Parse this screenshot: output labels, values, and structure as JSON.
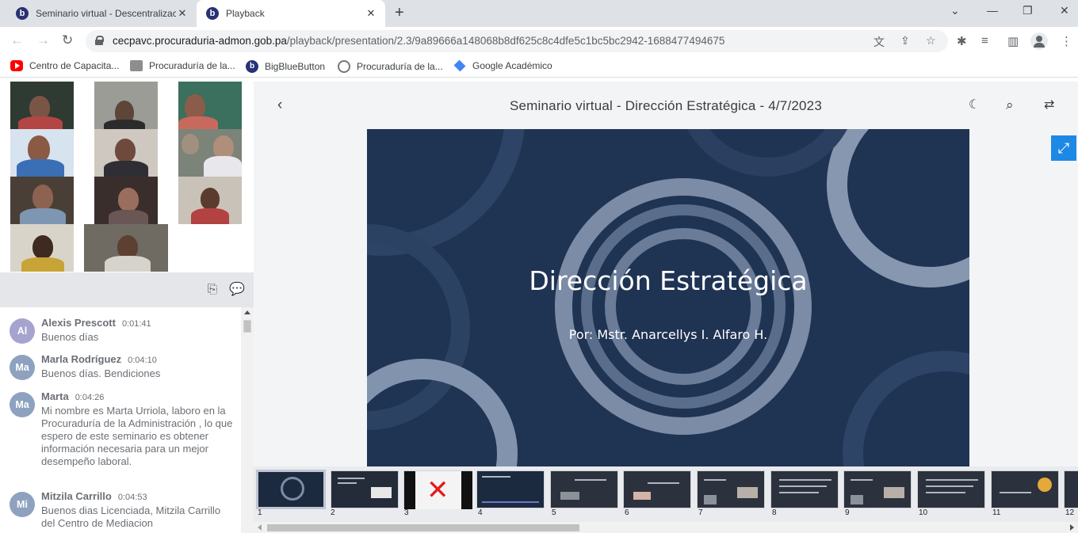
{
  "browser": {
    "tabs": [
      {
        "title": "Seminario virtual - Descentralizac",
        "favicon": "b"
      },
      {
        "title": "Playback",
        "favicon": "b"
      }
    ],
    "new_tab": "+",
    "window_controls": {
      "dropdown": "⌄",
      "minimize": "—",
      "restore": "❐",
      "close": "✕"
    },
    "url_domain": "cecpavc.procuraduria-admon.gob.pa",
    "url_path": "/playback/presentation/2.3/9a89666a148068b8df625c8c4dfe5c1bc5bc2942-1688477494675",
    "bookmarks": [
      {
        "label": "Centro de Capacita...",
        "icon": "youtube-icon"
      },
      {
        "label": "Procuraduría de la...",
        "icon": "document-icon"
      },
      {
        "label": "BigBlueButton",
        "icon": "bigbluebutton-icon"
      },
      {
        "label": "Procuraduría de la...",
        "icon": "globe-icon"
      },
      {
        "label": "Google Académico",
        "icon": "scholar-icon"
      }
    ]
  },
  "player": {
    "title": "Seminario virtual - Dirección Estratégica - 4/7/2023",
    "slide": {
      "title": "Dirección Estratégica",
      "subtitle": "Por: Mstr. Anarcellys I. Alfaro H."
    },
    "thumbnails": [
      "1",
      "2",
      "3",
      "4",
      "5",
      "6",
      "7",
      "8",
      "9",
      "10",
      "11",
      "12"
    ],
    "active_thumbnail": 1,
    "horizontal_scroll_position": 0.0
  },
  "chat": {
    "messages": [
      {
        "initials": "Al",
        "name": "Alexis Prescott",
        "time": "0:01:41",
        "text": "Buenos días"
      },
      {
        "initials": "Ma",
        "name": "Marla Rodríguez",
        "time": "0:04:10",
        "text": "Buenos días. Bendiciones"
      },
      {
        "initials": "Ma",
        "name": "Marta",
        "time": "0:04:26",
        "text": "Mi nombre es Marta Urriola, laboro en la Procuraduría de la Administración , lo que espero de este seminario es obtener información necesaria para un mejor desempeño laboral."
      },
      {
        "initials": "Mi",
        "name": "Mitzila Carrillo",
        "time": "0:04:53",
        "text": "Buenos dias Licenciada, Mitzila Carrillo del Centro de Mediacion"
      }
    ]
  },
  "colors": {
    "accent": "#1e88e5",
    "slide_background": "#1f3353",
    "tabstrip": "#dee1e6",
    "chat_header": "#e4e6ea"
  }
}
